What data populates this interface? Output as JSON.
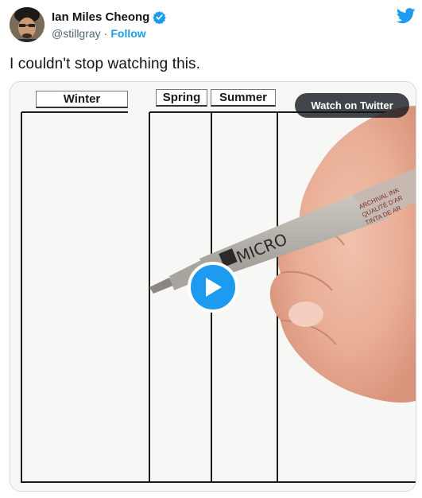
{
  "author": {
    "name": "Ian Miles Cheong",
    "handle": "@stillgray",
    "separator": "·",
    "follow_label": "Follow",
    "verified": true
  },
  "tweet": {
    "text": "I couldn't stop watching this."
  },
  "media": {
    "column_labels": [
      "Winter",
      "Spring",
      "Summer"
    ],
    "watch_label": "Watch on Twitter",
    "pen_text": [
      "ARCHIVAL INK",
      "QUALITÉ D'AR",
      "TINTA DE AR"
    ],
    "pen_brand": "MICRO"
  },
  "colors": {
    "accent": "#1d9bf0",
    "text_secondary": "#536471"
  },
  "icons": {
    "brand": "twitter-bird-icon",
    "verified": "verified-badge-icon",
    "play": "play-icon"
  }
}
